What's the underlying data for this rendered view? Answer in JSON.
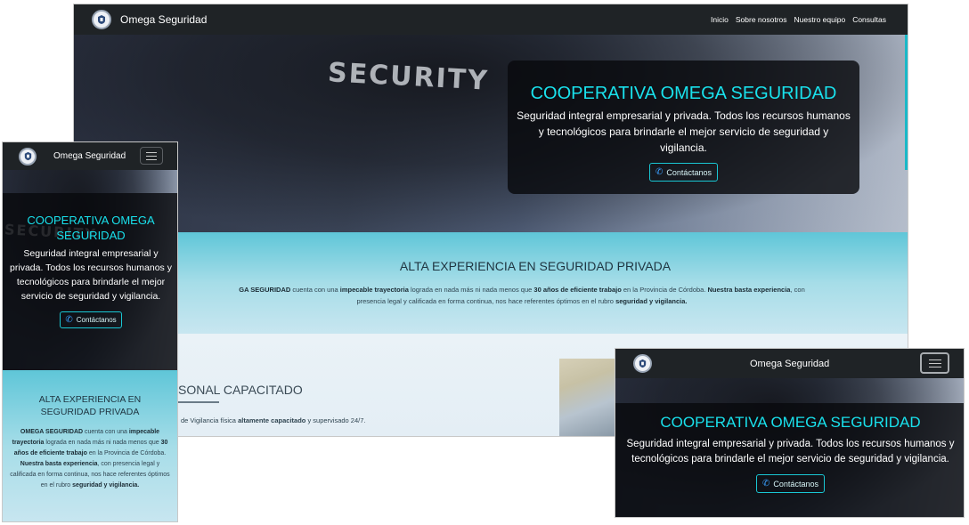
{
  "brand": "Omega Seguridad",
  "nav_links": [
    "Inicio",
    "Sobre nosotros",
    "Nuestro equipo",
    "Consultas"
  ],
  "hero": {
    "bg_word": "SECURITY",
    "title": "COOPERATIVA OMEGA SEGURIDAD",
    "text": "Seguridad integral empresarial y privada. Todos los recursos humanos y tecnológicos para brindarle el mejor servicio de seguridad y vigilancia.",
    "button": "Contáctanos",
    "button_icon": "phone-icon"
  },
  "experience": {
    "title": "ALTA EXPERIENCIA EN SEGURIDAD PRIVADA",
    "desktop_line1_a": "GA SEGURIDAD",
    "desktop_line1_b": " cuenta con una ",
    "desktop_line1_c": "impecable trayectoria",
    "desktop_line1_d": " lograda en nada más ni nada menos que ",
    "desktop_line1_e": "30 años de eficiente trabajo",
    "desktop_line1_f": " en la Provincia de Córdoba. ",
    "desktop_line1_g": "Nuestra basta experiencia",
    "desktop_line1_h": ", con",
    "desktop_line2_a": "presencia legal y calificada en forma continua, nos hace referentes óptimos en el rubro ",
    "desktop_line2_b": "seguridad y vigilancia.",
    "m_a": "OMEGA SEGURIDAD",
    "m_b": " cuenta con una ",
    "m_c": "impecable trayectoria",
    "m_d": " lograda en nada más ni nada menos que ",
    "m_e": "30 años de eficiente trabajo",
    "m_f": " en la Provincia de Córdoba. ",
    "m_g": "Nuestra basta experiencia",
    "m_h": ", con presencia legal y calificada en forma continua, nos hace referentes óptimos en el rubro ",
    "m_i": "seguridad y vigilancia."
  },
  "staff": {
    "title_visible": "SONAL CAPACITADO",
    "text_a": "de Vigilancia física ",
    "text_b": "altamente capacitado",
    "text_c": " y supervisado 24/7."
  },
  "colors": {
    "accent_cyan": "#19e1ec",
    "navbar": "#1f2326",
    "section_blue": "#a6dde8"
  }
}
